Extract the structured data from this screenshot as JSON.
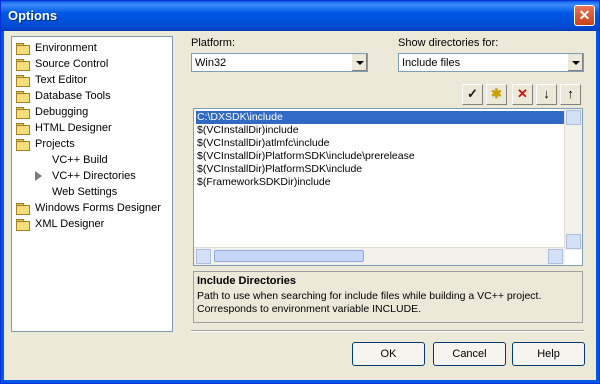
{
  "window": {
    "title": "Options",
    "close_glyph": "✕"
  },
  "tree": {
    "items": [
      {
        "label": "Environment",
        "icon": "folder-icon"
      },
      {
        "label": "Source Control",
        "icon": "folder-icon"
      },
      {
        "label": "Text Editor",
        "icon": "folder-icon"
      },
      {
        "label": "Database Tools",
        "icon": "folder-icon"
      },
      {
        "label": "Debugging",
        "icon": "folder-icon"
      },
      {
        "label": "HTML Designer",
        "icon": "folder-icon"
      },
      {
        "label": "Projects",
        "icon": "folder-open-icon"
      },
      {
        "label": "VC++ Build",
        "icon": ""
      },
      {
        "label": "VC++ Directories",
        "icon": "arrow-right-icon",
        "selected": true
      },
      {
        "label": "Web Settings",
        "icon": ""
      },
      {
        "label": "Windows Forms Designer",
        "icon": "folder-icon"
      },
      {
        "label": "XML Designer",
        "icon": "folder-icon"
      }
    ]
  },
  "platform": {
    "label": "Platform:",
    "value": "Win32"
  },
  "show_dirs": {
    "label": "Show directories for:",
    "value": "Include files"
  },
  "toolbar": {
    "check": "✓",
    "new_folder": "✱",
    "delete": "✕",
    "down": "↓",
    "up": "↑"
  },
  "directories": [
    "C:\\DXSDK\\include",
    "$(VCInstallDir)include",
    "$(VCInstallDir)atlmfc\\include",
    "$(VCInstallDir)PlatformSDK\\include\\prerelease",
    "$(VCInstallDir)PlatformSDK\\include",
    "$(FrameworkSDKDir)include"
  ],
  "description": {
    "title": "Include Directories",
    "text": "Path to use when searching for include files while building a VC++ project. Corresponds to environment variable INCLUDE."
  },
  "buttons": {
    "ok": "OK",
    "cancel": "Cancel",
    "help": "Help"
  },
  "colors": {
    "titlebar": "#0058e6",
    "selection": "#316ac5",
    "face": "#ece9d8"
  }
}
